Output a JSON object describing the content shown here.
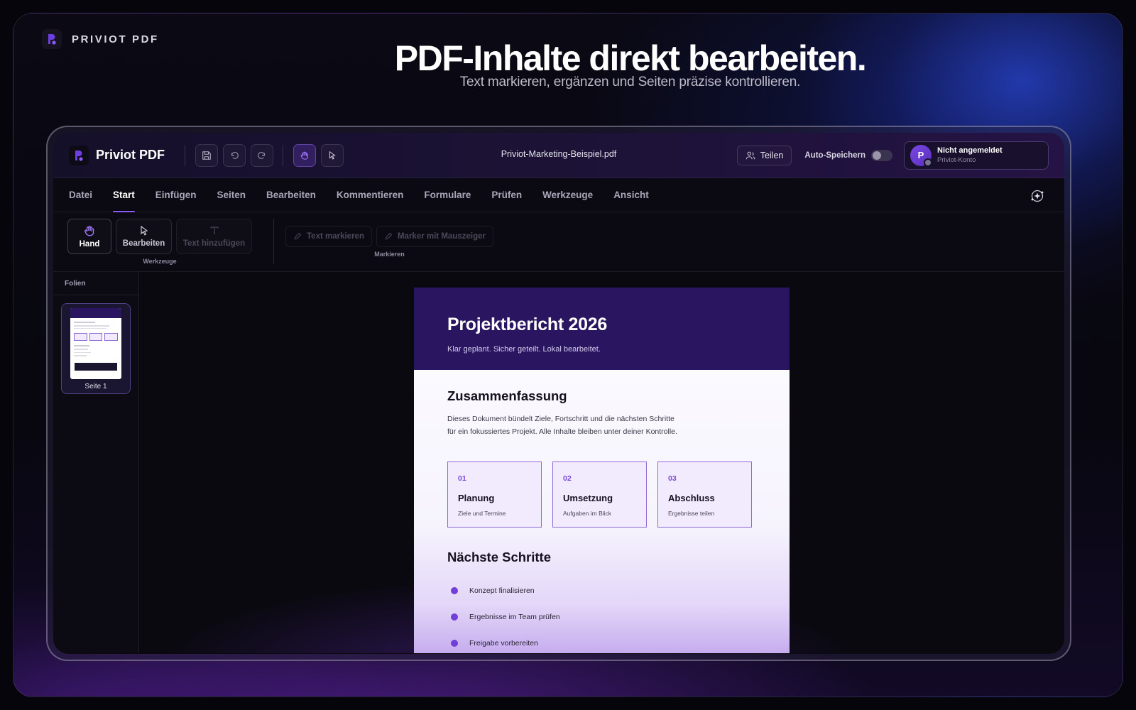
{
  "brand": {
    "name": "PRIVIOT PDF",
    "logo_icon": "priviot-logo-icon"
  },
  "hero": {
    "title": "PDF-Inhalte direkt bearbeiten.",
    "subtitle": "Text markieren, ergänzen und Seiten präzise kontrollieren."
  },
  "app": {
    "name": "Priviot PDF",
    "filename": "Priviot-Marketing-Beispiel.pdf",
    "toolbar_icons": [
      "save-icon",
      "undo-icon",
      "redo-icon",
      "hand-icon",
      "cursor-icon"
    ],
    "share_label": "Teilen",
    "autosave_label": "Auto-Speichern",
    "autosave_on": false,
    "account": {
      "initial": "P",
      "name": "Nicht angemeldet",
      "sub": "Priviot-Konto"
    }
  },
  "menu": {
    "items": [
      "Datei",
      "Start",
      "Einfügen",
      "Seiten",
      "Bearbeiten",
      "Kommentieren",
      "Formulare",
      "Prüfen",
      "Werkzeuge",
      "Ansicht"
    ],
    "active": "Start"
  },
  "ribbon": {
    "tools": {
      "label": "Werkzeuge",
      "hand": "Hand",
      "edit": "Bearbeiten",
      "add_text": "Text hinzufügen"
    },
    "mark": {
      "label": "Markieren",
      "highlight_text": "Text markieren",
      "marker_cursor": "Marker mit Mauszeiger"
    }
  },
  "sidebar": {
    "title": "Folien",
    "pages": [
      {
        "label": "Seite 1"
      }
    ]
  },
  "document": {
    "title": "Projektbericht 2026",
    "tagline": "Klar geplant. Sicher geteilt. Lokal bearbeitet.",
    "summary_heading": "Zusammenfassung",
    "summary_line1": "Dieses Dokument bündelt Ziele, Fortschritt und die nächsten Schritte",
    "summary_line2": "für ein fokussiertes Projekt. Alle Inhalte bleiben unter deiner Kontrolle.",
    "cards": [
      {
        "num": "01",
        "title": "Planung",
        "sub": "Ziele und Termine"
      },
      {
        "num": "02",
        "title": "Umsetzung",
        "sub": "Aufgaben im Blick"
      },
      {
        "num": "03",
        "title": "Abschluss",
        "sub": "Ergebnisse teilen"
      }
    ],
    "next_heading": "Nächste Schritte",
    "steps": [
      "Konzept finalisieren",
      "Ergebnisse im Team prüfen",
      "Freigabe vorbereiten"
    ]
  },
  "colors": {
    "accent": "#8b5cf6",
    "header": "#2a1560",
    "card_border": "#8c6ad8"
  }
}
